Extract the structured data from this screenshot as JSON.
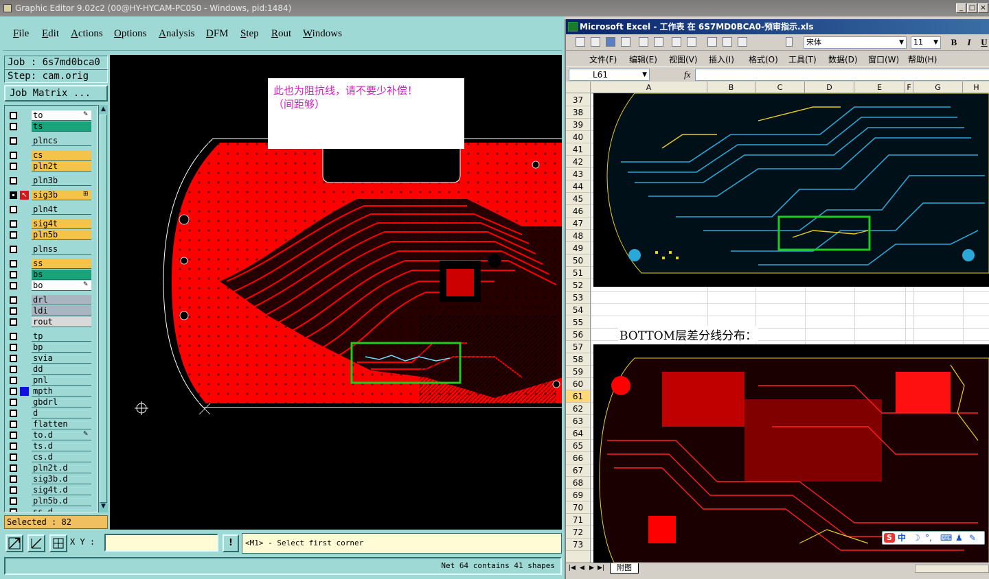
{
  "ge": {
    "title": "Graphic Editor 9.02c2 (00@HY-HYCAM-PC050 - Windows, pid:1484)",
    "menus": [
      "File",
      "Edit",
      "Actions",
      "Options",
      "Analysis",
      "DFM",
      "Step",
      "Rout",
      "Windows"
    ],
    "job_label": "Job : 6s7md0bca0",
    "step_label": "Step: cam.orig",
    "job_matrix_label": "Job Matrix ...",
    "layers": [
      {
        "name": "to",
        "color": "#ffffff",
        "tag": "✎"
      },
      {
        "name": "ts",
        "color": "#19a37a",
        "tag": ""
      },
      {
        "name": "plncs",
        "color": "#9fd9d6",
        "tag": ""
      },
      {
        "name": "cs",
        "color": "#f4c34a",
        "tag": ""
      },
      {
        "name": "pln2t",
        "color": "#f4c34a",
        "tag": ""
      },
      {
        "name": "pln3b",
        "color": "#9fd9d6",
        "tag": ""
      },
      {
        "name": "sig3b",
        "color": "#f4c34a",
        "tag": "⊞"
      },
      {
        "name": "pln4t",
        "color": "#9fd9d6",
        "tag": ""
      },
      {
        "name": "sig4t",
        "color": "#f4c34a",
        "tag": ""
      },
      {
        "name": "pln5b",
        "color": "#f4c34a",
        "tag": ""
      },
      {
        "name": "plnss",
        "color": "#9fd9d6",
        "tag": ""
      },
      {
        "name": "ss",
        "color": "#f4c34a",
        "tag": ""
      },
      {
        "name": "bs",
        "color": "#19a37a",
        "tag": ""
      },
      {
        "name": "bo",
        "color": "#ffffff",
        "tag": "✎"
      },
      {
        "name": "drl",
        "color": "#a9b6c2",
        "tag": ""
      },
      {
        "name": "ldi",
        "color": "#a9b6c2",
        "tag": ""
      },
      {
        "name": "rout",
        "color": "#d9d9d9",
        "tag": ""
      },
      {
        "name": "tp",
        "color": "#9fd9d6",
        "tag": ""
      },
      {
        "name": "bp",
        "color": "#9fd9d6",
        "tag": ""
      },
      {
        "name": "svia",
        "color": "#9fd9d6",
        "tag": ""
      },
      {
        "name": "dd",
        "color": "#9fd9d6",
        "tag": ""
      },
      {
        "name": "pnl",
        "color": "#9fd9d6",
        "tag": ""
      },
      {
        "name": "mpth",
        "color": "#9fd9d6",
        "tag": ""
      },
      {
        "name": "gbdrl",
        "color": "#9fd9d6",
        "tag": ""
      },
      {
        "name": "d",
        "color": "#9fd9d6",
        "tag": ""
      },
      {
        "name": "flatten",
        "color": "#9fd9d6",
        "tag": ""
      },
      {
        "name": "to.d",
        "color": "#9fd9d6",
        "tag": "✎"
      },
      {
        "name": "ts.d",
        "color": "#9fd9d6",
        "tag": ""
      },
      {
        "name": "cs.d",
        "color": "#9fd9d6",
        "tag": ""
      },
      {
        "name": "pln2t.d",
        "color": "#9fd9d6",
        "tag": ""
      },
      {
        "name": "sig3b.d",
        "color": "#9fd9d6",
        "tag": ""
      },
      {
        "name": "sig4t.d",
        "color": "#9fd9d6",
        "tag": ""
      },
      {
        "name": "pln5b.d",
        "color": "#9fd9d6",
        "tag": ""
      },
      {
        "name": "ss.d",
        "color": "#9fd9d6",
        "tag": ""
      }
    ],
    "selected_label": "Selected : 82",
    "xy_label": "X Y :",
    "xy_value": "",
    "go_label": "!",
    "prompt": "<M1> - Select first corner",
    "status": "Net 64 contains 41 shapes",
    "note_line1": "此也为阻抗线，请不要少补偿！",
    "note_line2": "（间距够）"
  },
  "xl": {
    "title": "Microsoft Excel - 工作表 在 6S7MD0BCA0-预审指示.xls",
    "font_name": "宋体",
    "font_size": "11",
    "bold": "B",
    "italic": "I",
    "underline": "U",
    "menus": [
      "文件(F)",
      "编辑(E)",
      "视图(V)",
      "插入(I)",
      "格式(O)",
      "工具(T)",
      "数据(D)",
      "窗口(W)",
      "帮助(H)"
    ],
    "name_box": "L61",
    "fx": "fx",
    "columns": [
      "A",
      "B",
      "C",
      "D",
      "E",
      "F",
      "G",
      "H"
    ],
    "rows": [
      "37",
      "38",
      "39",
      "40",
      "41",
      "42",
      "43",
      "44",
      "45",
      "46",
      "47",
      "48",
      "49",
      "50",
      "51",
      "52",
      "53",
      "54",
      "55",
      "56",
      "57",
      "58",
      "59",
      "60",
      "61",
      "62",
      "63",
      "64",
      "65",
      "66",
      "67",
      "68",
      "69",
      "70",
      "71",
      "72",
      "73"
    ],
    "active_row": "61",
    "cell_text": "BOTTOM层差分线分布：",
    "sheet_tab": "附图",
    "ime_label": "中"
  },
  "colors": {
    "copper": "#ff0000",
    "board_bg": "#000000",
    "highlight_box": "#1ecb1e",
    "cyan_trace": "#2aa8d8",
    "yellow_trace": "#e8d020",
    "note_text": "#d020c0"
  }
}
